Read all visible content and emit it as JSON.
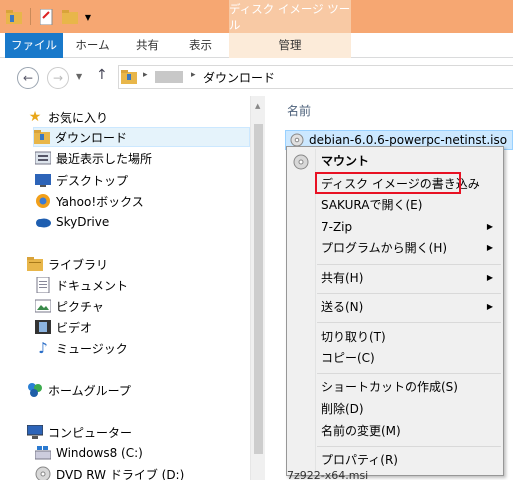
{
  "title_bar": {
    "context_title": "ディスク イメージ ツール"
  },
  "ribbon": {
    "tabs": [
      "ファイル",
      "ホーム",
      "共有",
      "表示",
      "管理"
    ]
  },
  "address": {
    "current": "ダウンロード"
  },
  "nav": {
    "favorites": "お気に入り",
    "downloads": "ダウンロード",
    "recent": "最近表示した場所",
    "desktop": "デスクトップ",
    "yahoo_box": "Yahoo!ボックス",
    "skydrive": "SkyDrive",
    "libraries": "ライブラリ",
    "documents": "ドキュメント",
    "pictures": "ピクチャ",
    "videos": "ビデオ",
    "music": "ミュージック",
    "homegroup": "ホームグループ",
    "computer": "コンピューター",
    "drive_c": "Windows8 (C:)",
    "drive_d": "DVD RW ドライブ (D:)"
  },
  "content": {
    "column_name": "名前",
    "selected_file": "debian-6.0.6-powerpc-netinst.iso",
    "partial_file": "7z922-x64.msi"
  },
  "context_menu": {
    "mount": "マウント",
    "burn": "ディスク イメージの書き込み",
    "open_sakura": "SAKURAで開く(E)",
    "zip": "7-Zip",
    "open_with": "プログラムから開く(H)",
    "share": "共有(H)",
    "send_to": "送る(N)",
    "cut": "切り取り(T)",
    "copy": "コピー(C)",
    "shortcut": "ショートカットの作成(S)",
    "delete": "削除(D)",
    "rename": "名前の変更(M)",
    "properties": "プロパティ(R)"
  },
  "colors": {
    "titlebar": "#f6a772",
    "file_tab": "#1979ca",
    "selection": "#cce8ff",
    "highlight_box": "#e81123"
  }
}
